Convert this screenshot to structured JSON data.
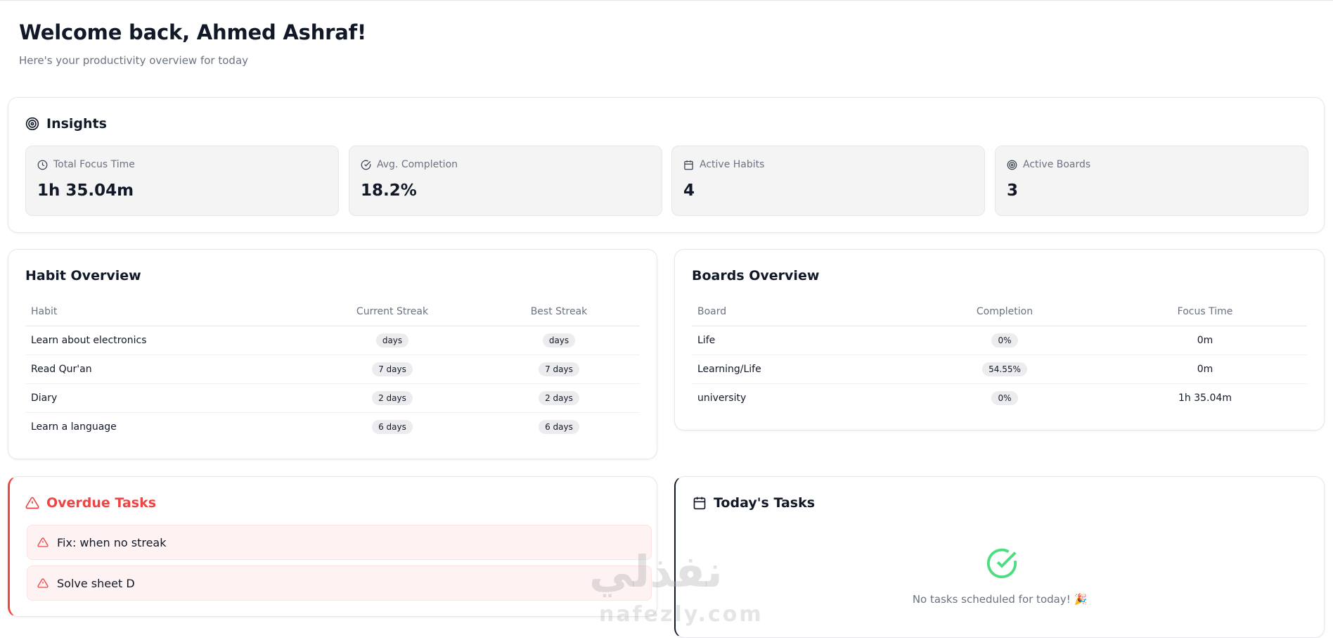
{
  "header": {
    "welcome": "Welcome back, Ahmed Ashraf!",
    "subtitle": "Here's your productivity overview for today"
  },
  "insights": {
    "title": "Insights",
    "stats": [
      {
        "label": "Total Focus Time",
        "value": "1h 35.04m",
        "icon": "clock-icon"
      },
      {
        "label": "Avg. Completion",
        "value": "18.2%",
        "icon": "check-circle-icon"
      },
      {
        "label": "Active Habits",
        "value": "4",
        "icon": "calendar-icon"
      },
      {
        "label": "Active Boards",
        "value": "3",
        "icon": "target-icon"
      }
    ]
  },
  "habits": {
    "title": "Habit Overview",
    "columns": [
      "Habit",
      "Current Streak",
      "Best Streak"
    ],
    "rows": [
      {
        "habit": "Learn about electronics",
        "current": "days",
        "best": "days"
      },
      {
        "habit": "Read Qur'an",
        "current": "7 days",
        "best": "7 days"
      },
      {
        "habit": "Diary",
        "current": "2 days",
        "best": "2 days"
      },
      {
        "habit": "Learn a language",
        "current": "6 days",
        "best": "6 days"
      }
    ]
  },
  "boards": {
    "title": "Boards Overview",
    "columns": [
      "Board",
      "Completion",
      "Focus Time"
    ],
    "rows": [
      {
        "board": "Life",
        "completion": "0%",
        "focus": "0m"
      },
      {
        "board": "Learning/Life",
        "completion": "54.55%",
        "focus": "0m"
      },
      {
        "board": "university",
        "completion": "0%",
        "focus": "1h 35.04m"
      }
    ]
  },
  "overdue": {
    "title": "Overdue Tasks",
    "items": [
      "Fix: when no streak",
      "Solve sheet D"
    ]
  },
  "today": {
    "title": "Today's Tasks",
    "empty": "No tasks scheduled for today! 🎉"
  },
  "watermark": {
    "arabic": "نفذلي",
    "latin": "nafezly.com"
  },
  "colors": {
    "danger": "#ef4444",
    "success": "#4ade80",
    "muted": "#6b7280"
  }
}
